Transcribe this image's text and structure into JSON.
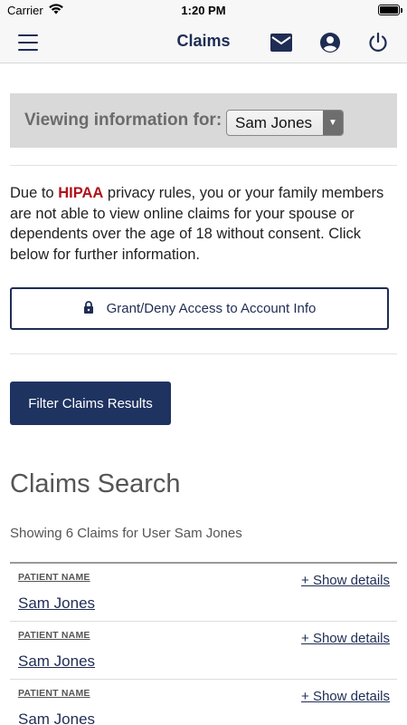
{
  "status": {
    "carrier": "Carrier",
    "time": "1:20 PM"
  },
  "nav": {
    "title": "Claims",
    "icons": {
      "menu": "menu-icon",
      "mail": "mail-icon",
      "account": "account-icon",
      "power": "power-icon"
    },
    "color": "#1f2d54"
  },
  "viewing": {
    "label": "Viewing information for:",
    "selected": "Sam Jones"
  },
  "notice": {
    "before": "Due to ",
    "highlight": "HIPAA",
    "after": " privacy rules, you or your family members are not able to view online claims for your spouse or dependents over the age of 18 without consent.  Click below for further information."
  },
  "access_button": {
    "label": "Grant/Deny Access to Account Info",
    "icon": "lock-icon"
  },
  "filter_button": {
    "label": "Filter Claims Results"
  },
  "claims_search": {
    "title": "Claims Search",
    "summary": "Showing 6 Claims for User Sam Jones",
    "rows": [
      {
        "label": "PATIENT NAME",
        "name": "Sam Jones",
        "details": "+ Show details"
      },
      {
        "label": "PATIENT NAME",
        "name": "Sam Jones",
        "details": "+ Show details"
      },
      {
        "label": "PATIENT NAME",
        "name": "Sam Jones",
        "details": "+ Show details"
      }
    ]
  },
  "colors": {
    "brand": "#1f2d54",
    "button": "#1f3361",
    "hipaa": "#b0121b",
    "banner": "#d9d9d9"
  }
}
